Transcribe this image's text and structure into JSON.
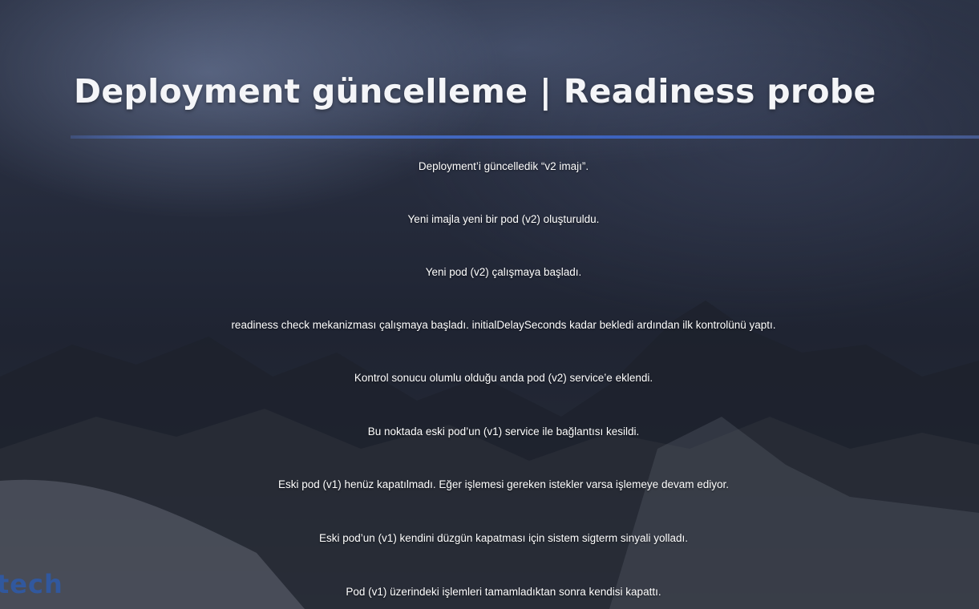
{
  "slide": {
    "title": "Deployment güncelleme | Readiness probe",
    "steps": [
      "Deployment’i güncelledik “v2 imajı”.",
      "Yeni imajla yeni bir pod (v2) oluşturuldu.",
      "Yeni pod (v2) çalışmaya başladı.",
      "readiness check mekanizması çalışmaya başladı. initialDelaySeconds kadar bekledi ardından ilk kontrolünü yaptı.",
      "Kontrol sonucu olumlu olduğu anda pod (v2) service’e eklendi.",
      "Bu noktada eski pod’un (v1) service ile bağlantısı kesildi.",
      "Eski pod (v1) henüz kapatılmadı. Eğer işlemesi gereken istekler varsa işlemeye devam ediyor.",
      "Eski pod’un (v1) kendini düzgün kapatması için sistem sigterm sinyali yolladı.",
      "Pod (v1) üzerindeki işlemleri tamamladıktan sonra kendisi kapattı."
    ]
  },
  "logo": {
    "text": "tech"
  },
  "colors": {
    "title": "#f4f5f8",
    "divider": "#3d63be",
    "logo": "#2f5aa6",
    "background": "#262c3d"
  }
}
